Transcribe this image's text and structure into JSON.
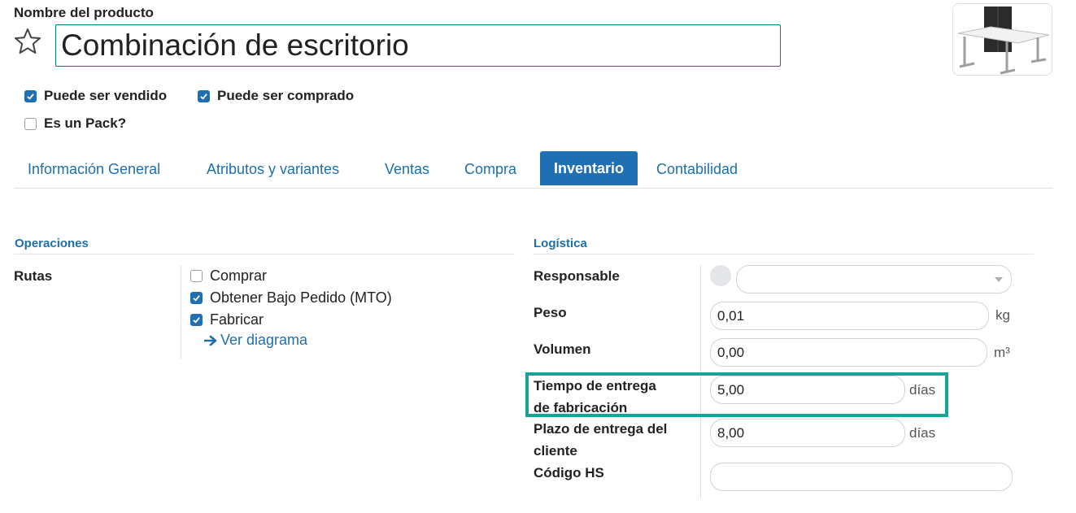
{
  "header": {
    "product_name_label": "Nombre del producto",
    "product_name_value": "Combinación de escritorio"
  },
  "flags": [
    {
      "label": "Puede ser vendido",
      "checked": true
    },
    {
      "label": "Puede ser comprado",
      "checked": true
    },
    {
      "label": "Es un Pack?",
      "checked": false
    }
  ],
  "tabs": [
    {
      "label": "Información General",
      "active": false
    },
    {
      "label": "Atributos y variantes",
      "active": false
    },
    {
      "label": "Ventas",
      "active": false
    },
    {
      "label": "Compra",
      "active": false
    },
    {
      "label": "Inventario",
      "active": true
    },
    {
      "label": "Contabilidad",
      "active": false
    }
  ],
  "operaciones": {
    "title": "Operaciones",
    "routes_label": "Rutas",
    "routes": [
      {
        "label": "Comprar",
        "checked": false
      },
      {
        "label": "Obtener Bajo Pedido (MTO)",
        "checked": true
      },
      {
        "label": "Fabricar",
        "checked": true
      }
    ],
    "diagram_link": "Ver diagrama"
  },
  "logistica": {
    "title": "Logística",
    "responsable_label": "Responsable",
    "responsable_value": "",
    "peso_label": "Peso",
    "peso_value": "0,01",
    "peso_unit": "kg",
    "volumen_label": "Volumen",
    "volumen_value": "0,00",
    "volumen_unit": "m³",
    "fabricacion_label_1": "Tiempo de entrega",
    "fabricacion_label_2": "de fabricación",
    "fabricacion_value": "5,00",
    "fabricacion_unit": "días",
    "cliente_label_1": "Plazo de entrega del",
    "cliente_label_2": "cliente",
    "cliente_value": "8,00",
    "cliente_unit": "días",
    "hs_label": "Código HS",
    "hs_value": ""
  },
  "colors": {
    "accent": "#1f6fb2",
    "title_border": "#017e84",
    "highlight": "#17a39a"
  }
}
